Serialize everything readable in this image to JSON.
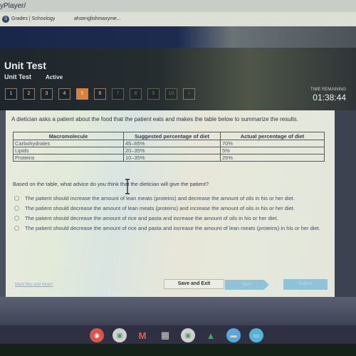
{
  "browser": {
    "url_fragment": "yPlayer/",
    "tabs": [
      {
        "label": "Grades | Schoology",
        "icon": "schoology-icon"
      },
      {
        "label": "ahsenglishmaxyme..."
      }
    ]
  },
  "header": {
    "title": "Unit Test",
    "subtitle": "Unit Test",
    "status": "Active",
    "time_remaining_label": "TIME REMAINING",
    "time_remaining": "01:38:44"
  },
  "question_nav": {
    "items": [
      {
        "label": "1",
        "state": "normal"
      },
      {
        "label": "2",
        "state": "normal"
      },
      {
        "label": "3",
        "state": "normal"
      },
      {
        "label": "4",
        "state": "normal"
      },
      {
        "label": "5",
        "state": "active"
      },
      {
        "label": "6",
        "state": "normal"
      },
      {
        "label": "7",
        "state": "dim"
      },
      {
        "label": "8",
        "state": "dim"
      },
      {
        "label": "9",
        "state": "dim"
      },
      {
        "label": "10",
        "state": "dim"
      }
    ],
    "next_icon": "arrow-right-icon",
    "active_color": "#d9823c"
  },
  "question": {
    "prompt": "A dietician asks a patient about the food that the patient eats and makes the table below to summarize the results.",
    "table": {
      "headers": [
        "Macromolecule",
        "Suggested percentage of diet",
        "Actual percentage of diet"
      ],
      "rows": [
        [
          "Carbohydrates",
          "45–65%",
          "70%"
        ],
        [
          "Lipids",
          "20–35%",
          "5%"
        ],
        [
          "Proteins",
          "10–35%",
          "25%"
        ]
      ]
    },
    "stem": "Based on the table, what advice do you think that the dietician will give the patient?",
    "options": [
      "The patient should increase the amount of lean meats (proteins) and decrease the amount of oils in his or her diet.",
      "The patient should decrease the amount of lean meats (proteins) and increase the amount of oils in his or her diet.",
      "The patient should decrease the amount of rice and pasta and increase the amount of oils in his or her diet.",
      "The patient should decrease the amount of rice and pasta and increase the amount of lean meats (proteins) in his or her diet."
    ]
  },
  "footer": {
    "mark_link": "Mark this and return",
    "save_exit": "Save and Exit",
    "next": "Next",
    "submit": "Submit",
    "button_color": "#8fc3d6"
  },
  "shelf": {
    "apps": [
      {
        "name": "chrome-icon",
        "glyph": "◉",
        "color": "#d9574a"
      },
      {
        "name": "camera-icon",
        "glyph": "▣",
        "color": "#d9d9d9"
      },
      {
        "name": "gmail-icon",
        "glyph": "M",
        "color": "#3f6fcf"
      },
      {
        "name": "calculator-icon",
        "glyph": "▦",
        "color": "#c8c8c8"
      },
      {
        "name": "camera-icon-2",
        "glyph": "▣",
        "color": "#d9d9d9"
      },
      {
        "name": "google-drive-icon",
        "glyph": "▲",
        "color": "#3aa860"
      },
      {
        "name": "files-icon",
        "glyph": "▬",
        "color": "#5ba7dd"
      },
      {
        "name": "screen-cast-icon",
        "glyph": "▭",
        "color": "#55b3d6"
      }
    ]
  }
}
